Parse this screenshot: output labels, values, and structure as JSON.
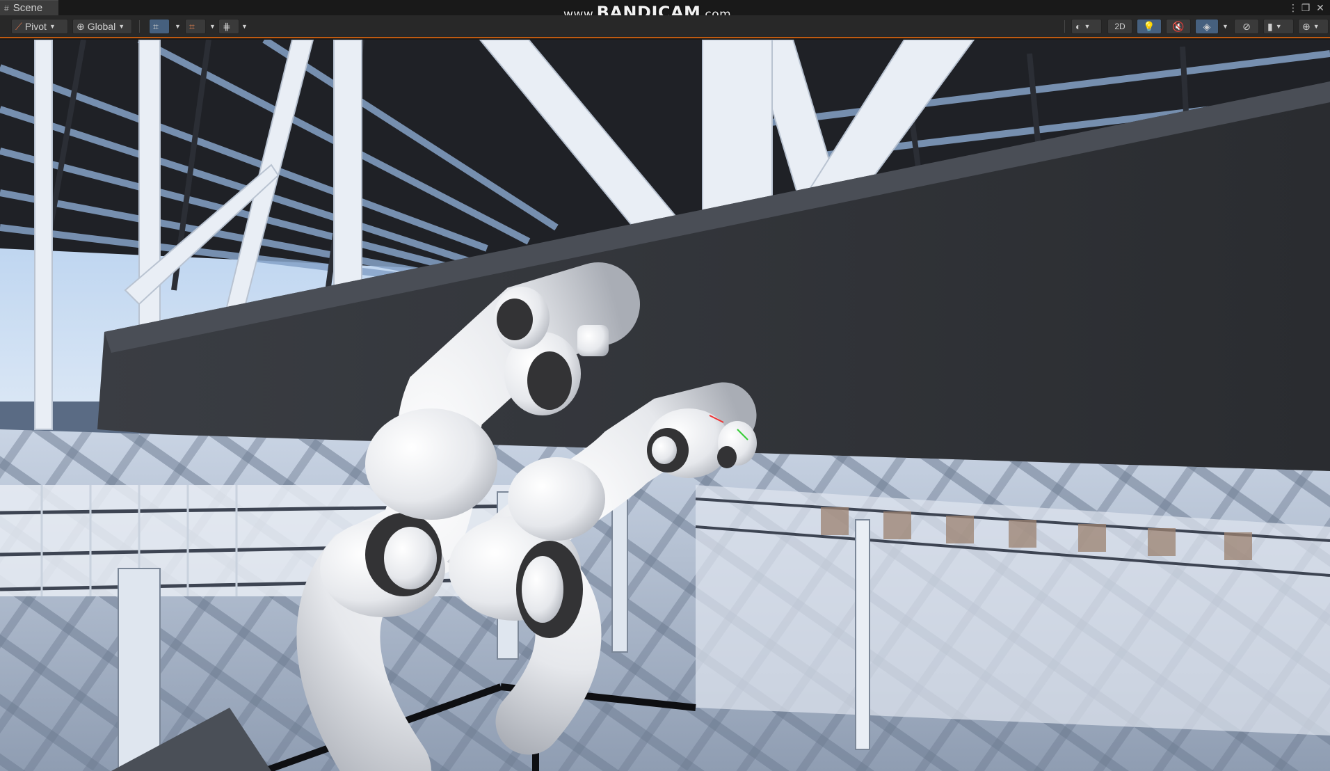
{
  "window": {
    "tab_label": "Scene",
    "tab_icon": "scene-grid-icon",
    "menu_icon": "kebab-menu-icon",
    "maximize_icon": "maximize-icon",
    "close_icon": "close-icon"
  },
  "watermark": {
    "prefix": "www.",
    "brand": "BANDICAM",
    "suffix": ".com"
  },
  "toolbar": {
    "pivot_label": "Pivot",
    "global_label": "Global",
    "two_d_label": "2D",
    "left_tools": [
      "transform-grid-icon",
      "snap-grid-icon",
      "increment-snap-icon"
    ],
    "right_tools": [
      "shading-mode-icon",
      "2d-toggle",
      "lighting-icon",
      "audio-icon",
      "effects-icon",
      "hidden-objects-icon",
      "camera-icon",
      "gizmos-icon"
    ],
    "accent_color": "#c05a10",
    "active_button_color": "#46607e"
  },
  "scene": {
    "sky_color": "#8fb4e0",
    "structure_color": "#e8eef6",
    "shadow_color": "#2a2c30",
    "robot_color": "#f2f2f2",
    "robot_joint_color": "#333335"
  }
}
